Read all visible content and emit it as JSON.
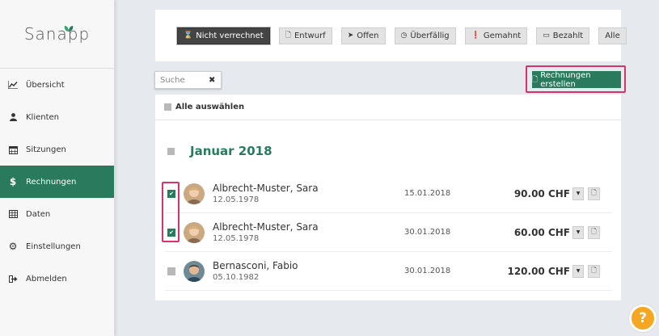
{
  "app": {
    "logo_text": "Sanapp"
  },
  "sidebar": {
    "items": [
      {
        "label": "Übersicht",
        "icon": "chart-line-icon"
      },
      {
        "label": "Klienten",
        "icon": "user-icon"
      },
      {
        "label": "Sitzungen",
        "icon": "calendar-icon"
      },
      {
        "label": "Rechnungen",
        "icon": "dollar-icon",
        "active": true
      },
      {
        "label": "Daten",
        "icon": "table-icon"
      },
      {
        "label": "Einstellungen",
        "icon": "gear-icon"
      },
      {
        "label": "Abmelden",
        "icon": "sign-out-icon"
      }
    ]
  },
  "filters": [
    {
      "label": "Nicht verrechnet",
      "icon": "hourglass-icon",
      "active": true
    },
    {
      "label": "Entwurf",
      "icon": "file-icon"
    },
    {
      "label": "Offen",
      "icon": "paper-plane-icon"
    },
    {
      "label": "Überfällig",
      "icon": "clock-icon"
    },
    {
      "label": "Gemahnt",
      "icon": "exclamation-icon"
    },
    {
      "label": "Bezahlt",
      "icon": "money-icon"
    },
    {
      "label": "Alle",
      "icon": ""
    }
  ],
  "search": {
    "placeholder": "Suche"
  },
  "actions": {
    "create_label": "Rechnungen erstellen"
  },
  "list": {
    "select_all_label": "Alle auswählen",
    "month_title": "Januar 2018",
    "rows": [
      {
        "name": "Albrecht-Muster, Sara",
        "dob": "12.05.1978",
        "date": "15.01.2018",
        "amount": "90.00 CHF",
        "checked": true
      },
      {
        "name": "Albrecht-Muster, Sara",
        "dob": "12.05.1978",
        "date": "30.01.2018",
        "amount": "60.00 CHF",
        "checked": true
      },
      {
        "name": "Bernasconi, Fabio",
        "dob": "05.10.1982",
        "date": "30.01.2018",
        "amount": "120.00 CHF",
        "checked": false
      }
    ]
  },
  "colors": {
    "brand": "#2a7a5e",
    "highlight": "#d6336c",
    "help": "#f5a623"
  },
  "help": {
    "label": "?"
  }
}
